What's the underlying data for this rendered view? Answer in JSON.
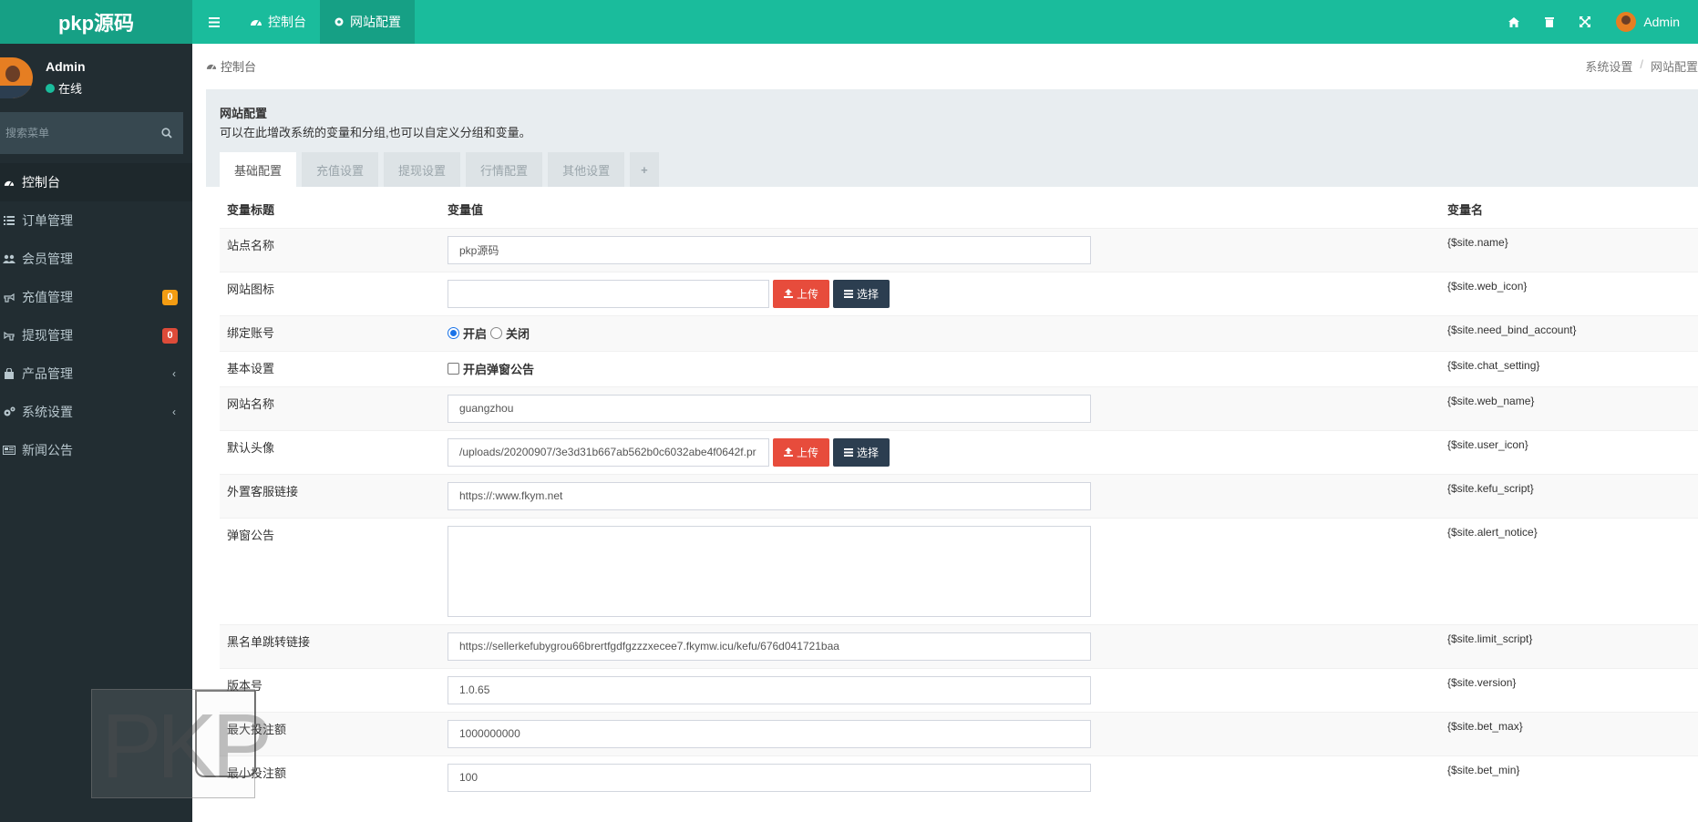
{
  "header": {
    "logo": "pkp源码",
    "nav": [
      {
        "label": "控制台",
        "icon": "dashboard-icon"
      },
      {
        "label": "网站配置",
        "icon": "gear-icon"
      }
    ],
    "admin_label": "Admin"
  },
  "sidebar": {
    "user": {
      "name": "Admin",
      "status": "在线"
    },
    "search_placeholder": "搜索菜单",
    "items": [
      {
        "label": "控制台",
        "icon": "dashboard-icon"
      },
      {
        "label": "订单管理",
        "icon": "list-icon"
      },
      {
        "label": "会员管理",
        "icon": "users-icon"
      },
      {
        "label": "充值管理",
        "icon": "hand-right-icon",
        "badge": "0"
      },
      {
        "label": "提现管理",
        "icon": "hand-left-icon",
        "badge": "0"
      },
      {
        "label": "产品管理",
        "icon": "shopping-bag-icon"
      },
      {
        "label": "系统设置",
        "icon": "cogs-icon"
      },
      {
        "label": "新闻公告",
        "icon": "newspaper-icon"
      }
    ]
  },
  "breadcrumb": {
    "current": "控制台",
    "trail": [
      "系统设置",
      "网站配置"
    ]
  },
  "panel": {
    "title": "网站配置",
    "description": "可以在此增改系统的变量和分组,也可以自定义分组和变量。",
    "tabs": [
      "基础配置",
      "充值设置",
      "提现设置",
      "行情配置",
      "其他设置",
      "+"
    ]
  },
  "table": {
    "headers": [
      "变量标题",
      "变量值",
      "变量名"
    ],
    "buttons": {
      "upload": "上传",
      "select": "选择"
    },
    "rows": [
      {
        "title": "站点名称",
        "value": "pkp源码",
        "var": "{$site.name}"
      },
      {
        "title": "网站图标",
        "value": "",
        "var": "{$site.web_icon}"
      },
      {
        "title": "绑定账号",
        "options": [
          "开启",
          "关闭"
        ],
        "var": "{$site.need_bind_account}"
      },
      {
        "title": "基本设置",
        "checkbox_label": "开启弹窗公告",
        "var": "{$site.chat_setting}"
      },
      {
        "title": "网站名称",
        "value": "guangzhou",
        "var": "{$site.web_name}"
      },
      {
        "title": "默认头像",
        "value": "/uploads/20200907/3e3d31b667ab562b0c6032abe4f0642f.pr",
        "var": "{$site.user_icon}"
      },
      {
        "title": "外置客服链接",
        "value": "https://:www.fkym.net",
        "var": "{$site.kefu_script}"
      },
      {
        "title": "弹窗公告",
        "value": "",
        "var": "{$site.alert_notice}"
      },
      {
        "title": "黑名单跳转链接",
        "value": "https://sellerkefubygrou66brertfgdfgzzzxecee7.fkymw.icu/kefu/676d041721baa",
        "var": "{$site.limit_script}"
      },
      {
        "title": "版本号",
        "value": "1.0.65",
        "var": "{$site.version}"
      },
      {
        "title": "最大投注额",
        "value": "1000000000",
        "var": "{$site.bet_max}"
      },
      {
        "title": "最小投注额",
        "value": "100",
        "var": "{$site.bet_min}"
      }
    ]
  },
  "watermark": "PKP",
  "colors": {
    "topbar": "#1abc9c",
    "sidebar": "#222d32",
    "upload_btn": "#e74c3c",
    "select_btn": "#2c3e50"
  }
}
